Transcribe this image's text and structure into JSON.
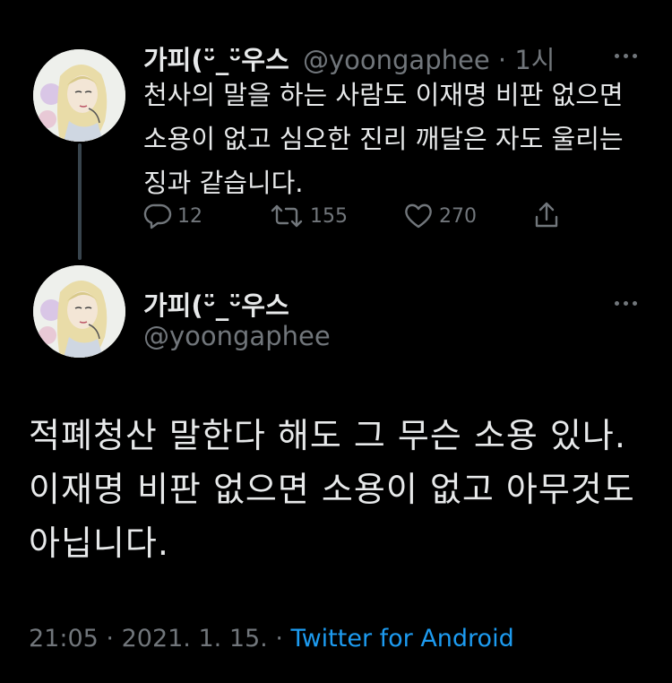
{
  "tweet1": {
    "display_name": "가피(ᵕ̈_ᵕ̈우스",
    "handle": "@yoongaphee",
    "separator": "·",
    "time": "1시",
    "text": "천사의 말을 하는 사람도 이재명 비판 없으면 소용이 없고 심오한 진리 깨달은 자도 울리는 징과 같습니다.",
    "replies": "12",
    "retweets": "155",
    "likes": "270"
  },
  "tweet2": {
    "display_name": "가피(ᵕ̈_ᵕ̈우스",
    "handle": "@yoongaphee",
    "text": "적폐청산 말한다 해도 그 무슨 소용 있나. 이재명 비판 없으면 소용이 없고 아무것도 아닙니다.",
    "time": "21:05",
    "date": "2021. 1. 15.",
    "sep": "·",
    "source": "Twitter for Android"
  },
  "colors": {
    "background": "#000000",
    "text": "#e7e9ea",
    "secondary": "#71767b",
    "link": "#1d9bf0"
  },
  "icons": [
    "reply-icon",
    "retweet-icon",
    "like-icon",
    "share-icon",
    "more-icon",
    "avatar"
  ]
}
